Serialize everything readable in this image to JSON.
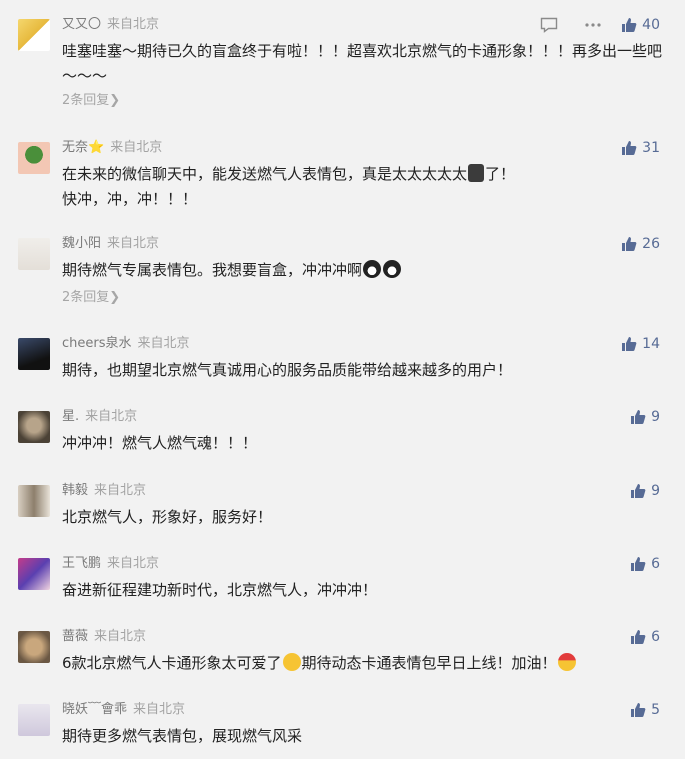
{
  "ui": {
    "location_tag": "来自北京",
    "reply_suffix": "条回复"
  },
  "colors": {
    "background": "#f2f2f2",
    "link": "#576b95",
    "meta": "#a3a3a3",
    "text": "#222222"
  },
  "comments": [
    {
      "nickname": "又又〇",
      "location": "来自北京",
      "text": "哇塞哇塞～期待已久的盲盒终于有啦！！！超喜欢北京燃气的卡通形象！！！再多出一些吧～～～",
      "likes": "40",
      "replies": "2条回复"
    },
    {
      "nickname": "无奈⭐",
      "location": "来自北京",
      "text": "在未来的微信聊天中，能发送燃气人表情包，真是太太太太太",
      "text2": "了！",
      "text_line2": "快冲，冲，冲！！！",
      "likes": "31"
    },
    {
      "nickname": "魏小阳",
      "location": "来自北京",
      "text": "期待燃气专属表情包。我想要盲盒，冲冲冲啊",
      "likes": "26",
      "replies": "2条回复"
    },
    {
      "nickname": "cheers泉水",
      "location": "来自北京",
      "text": "期待，也期望北京燃气真诚用心的服务品质能带给越来越多的用户！",
      "likes": "14"
    },
    {
      "nickname": "星.",
      "location": "来自北京",
      "text": "冲冲冲！燃气人燃气魂！！！",
      "likes": "9"
    },
    {
      "nickname": "韩毅",
      "location": "来自北京",
      "text": "北京燃气人，形象好，服务好！",
      "likes": "9"
    },
    {
      "nickname": "王飞鹏",
      "location": "来自北京",
      "text": "奋进新征程建功新时代，北京燃气人，冲冲冲！",
      "likes": "6"
    },
    {
      "nickname": "蔷薇",
      "location": "来自北京",
      "text": "6款北京燃气人卡通形象太可爱了",
      "text2": "期待动态卡通表情包早日上线！加油！",
      "likes": "6"
    },
    {
      "nickname": "晓妖﹋會乖",
      "location": "来自北京",
      "text": "期待更多燃气表情包，展现燃气风采",
      "likes": "5"
    }
  ]
}
